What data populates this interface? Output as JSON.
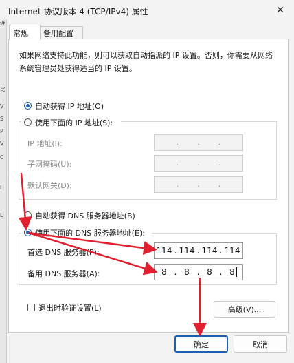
{
  "window": {
    "title": "Internet 协议版本 4 (TCP/IPv4) 属性",
    "close_glyph": "✕"
  },
  "side_fragments": [
    "连",
    "C",
    "比",
    "V",
    "S",
    "P",
    "V",
    "C",
    "I",
    "L",
    "V",
    "S"
  ],
  "tabs": [
    {
      "label": "常规"
    },
    {
      "label": "备用配置"
    }
  ],
  "description": "如果网络支持此功能，则可以获取自动指派的 IP 设置。否则，你需要从网络系统管理员处获得适当的 IP 设置。",
  "ip": {
    "auto_label": "自动获得 IP 地址(O)",
    "manual_label": "使用下面的 IP 地址(S):",
    "address_label": "IP 地址(I):",
    "subnet_label": "子网掩码(U):",
    "gateway_label": "默认网关(D):",
    "empty_dot": "."
  },
  "dns": {
    "auto_label": "自动获得 DNS 服务器地址(B)",
    "manual_label": "使用下面的 DNS 服务器地址(E):",
    "preferred_label": "首选 DNS 服务器(P):",
    "alternate_label": "备用 DNS 服务器(A):",
    "preferred": [
      "114",
      "114",
      "114",
      "114"
    ],
    "alternate": [
      "8",
      "8",
      "8",
      "8"
    ],
    "dot": "."
  },
  "validate_label": "退出时验证设置(L)",
  "advanced_label": "高级(V)...",
  "ok_label": "确定",
  "cancel_label": "取消",
  "colors": {
    "accent": "#1a5fb4",
    "arrow": "#e0202e"
  }
}
